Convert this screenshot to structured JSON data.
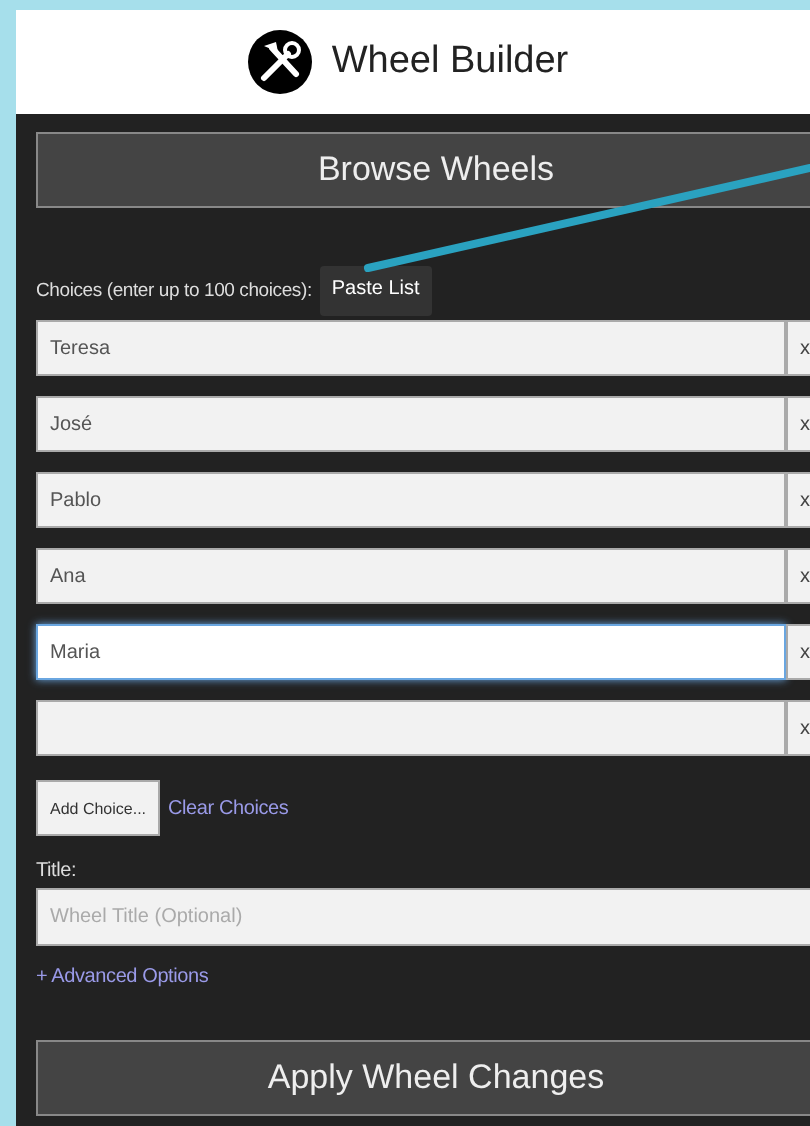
{
  "header": {
    "title": "Wheel Builder"
  },
  "browse_button": "Browse Wheels",
  "choices_label": "Choices (enter up to 100 choices):",
  "paste_button": "Paste List",
  "choices": [
    {
      "value": "Teresa",
      "focused": false,
      "remove": "x"
    },
    {
      "value": "José",
      "focused": false,
      "remove": "x"
    },
    {
      "value": "Pablo",
      "focused": false,
      "remove": "x"
    },
    {
      "value": "Ana",
      "focused": false,
      "remove": "x"
    },
    {
      "value": "Maria",
      "focused": true,
      "remove": "x"
    },
    {
      "focused": false,
      "remove": "x"
    }
  ],
  "add_button": "Add Choice...",
  "clear_link": "Clear Choices",
  "title_label": "Title:",
  "title_field": {
    "placeholder": "Wheel Title (Optional)"
  },
  "advanced_link": "+ Advanced Options",
  "apply_button": "Apply Wheel Changes"
}
